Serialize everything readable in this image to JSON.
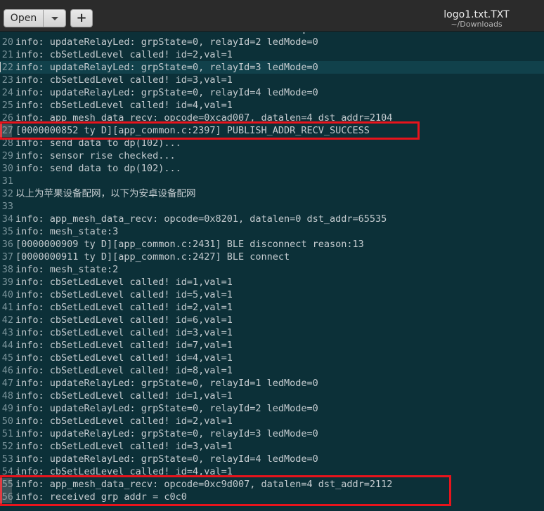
{
  "window": {
    "title": "logo1.txt.TXT",
    "subtitle": "~/Downloads"
  },
  "toolbar": {
    "open_label": "Open",
    "dropdown_icon": "chevron-down-icon",
    "new_label": "+",
    "new_icon": "plus-icon"
  },
  "editor": {
    "partial_top_line": "                                                  :",
    "current_line_number": "22",
    "lines": [
      {
        "num": "20",
        "text": "info: updateRelayLed: grpState=0, relayId=2 ledMode=0"
      },
      {
        "num": "21",
        "text": "info: cbSetLedLevel called! id=2,val=1"
      },
      {
        "num": "22",
        "text": "info: updateRelayLed: grpState=0, relayId=3 ledMode=0"
      },
      {
        "num": "23",
        "text": "info: cbSetLedLevel called! id=3,val=1"
      },
      {
        "num": "24",
        "text": "info: updateRelayLed: grpState=0, relayId=4 ledMode=0"
      },
      {
        "num": "25",
        "text": "info: cbSetLedLevel called! id=4,val=1"
      },
      {
        "num": "26",
        "text": "info: app_mesh_data_recv: opcode=0xcad007, datalen=4 dst_addr=2104"
      },
      {
        "num": "27",
        "text": "[0000000852 ty D][app_common.c:2397] PUBLISH_ADDR_RECV_SUCCESS"
      },
      {
        "num": "28",
        "text": "info: send data to dp(102)..."
      },
      {
        "num": "29",
        "text": "info: sensor rise checked..."
      },
      {
        "num": "30",
        "text": "info: send data to dp(102)..."
      },
      {
        "num": "31",
        "text": ""
      },
      {
        "num": "32",
        "text": "以上为苹果设备配网，以下为安卓设备配网"
      },
      {
        "num": "33",
        "text": ""
      },
      {
        "num": "34",
        "text": "info: app_mesh_data_recv: opcode=0x8201, datalen=0 dst_addr=65535"
      },
      {
        "num": "35",
        "text": "info: mesh_state:3"
      },
      {
        "num": "36",
        "text": "[0000000909 ty D][app_common.c:2431] BLE disconnect reason:13"
      },
      {
        "num": "37",
        "text": "[0000000911 ty D][app_common.c:2427] BLE connect"
      },
      {
        "num": "38",
        "text": "info: mesh_state:2"
      },
      {
        "num": "39",
        "text": "info: cbSetLedLevel called! id=1,val=1"
      },
      {
        "num": "40",
        "text": "info: cbSetLedLevel called! id=5,val=1"
      },
      {
        "num": "41",
        "text": "info: cbSetLedLevel called! id=2,val=1"
      },
      {
        "num": "42",
        "text": "info: cbSetLedLevel called! id=6,val=1"
      },
      {
        "num": "43",
        "text": "info: cbSetLedLevel called! id=3,val=1"
      },
      {
        "num": "44",
        "text": "info: cbSetLedLevel called! id=7,val=1"
      },
      {
        "num": "45",
        "text": "info: cbSetLedLevel called! id=4,val=1"
      },
      {
        "num": "46",
        "text": "info: cbSetLedLevel called! id=8,val=1"
      },
      {
        "num": "47",
        "text": "info: updateRelayLed: grpState=0, relayId=1 ledMode=0"
      },
      {
        "num": "48",
        "text": "info: cbSetLedLevel called! id=1,val=1"
      },
      {
        "num": "49",
        "text": "info: updateRelayLed: grpState=0, relayId=2 ledMode=0"
      },
      {
        "num": "50",
        "text": "info: cbSetLedLevel called! id=2,val=1"
      },
      {
        "num": "51",
        "text": "info: updateRelayLed: grpState=0, relayId=3 ledMode=0"
      },
      {
        "num": "52",
        "text": "info: cbSetLedLevel called! id=3,val=1"
      },
      {
        "num": "53",
        "text": "info: updateRelayLed: grpState=0, relayId=4 ledMode=0"
      },
      {
        "num": "54",
        "text": "info: cbSetLedLevel called! id=4,val=1"
      },
      {
        "num": "55",
        "text": "info: app_mesh_data_recv: opcode=0xc9d007, datalen=4 dst_addr=2112"
      },
      {
        "num": "56",
        "text": "info: received grp addr = c0c0"
      }
    ]
  },
  "annotations": {
    "box_color": "#e8141c",
    "highlighted_lines": [
      "27",
      "55",
      "56"
    ]
  },
  "colors": {
    "background": "#0c3038",
    "current_line": "#11414b",
    "text": "#c5ccd0",
    "gutter_text": "#7b949b"
  }
}
